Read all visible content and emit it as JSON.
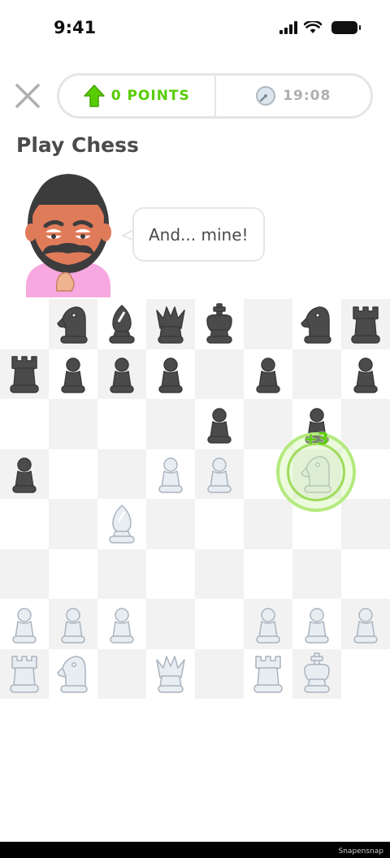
{
  "status_bar": {
    "time": "9:41"
  },
  "header": {
    "points_label": "0 POINTS",
    "timer_label": "19:08"
  },
  "page_title": "Play Chess",
  "opponent": {
    "speech": "And... mine!"
  },
  "move_feedback": {
    "score": "+3"
  },
  "watermark": "Snapensnap",
  "colors": {
    "accent_green": "#58cc02",
    "pill_border": "#e5e5e5",
    "dark_square": "#f2f2f2",
    "black_piece": "#4b4b4b",
    "white_piece": "#e8edf2"
  },
  "board": {
    "ranks": [
      [
        "",
        "bN",
        "bB",
        "bQ",
        "bK",
        "",
        "bN",
        "bR"
      ],
      [
        "bR",
        "bP",
        "bP",
        "bP",
        "",
        "bP",
        "",
        "bP"
      ],
      [
        "",
        "",
        "",
        "",
        "bP",
        "",
        "bP",
        ""
      ],
      [
        "bP",
        "",
        "",
        "wP",
        "wP",
        "",
        "wN",
        ""
      ],
      [
        "",
        "",
        "wB",
        "",
        "",
        "",
        "",
        ""
      ],
      [
        "",
        "",
        "",
        "",
        "",
        "",
        "",
        ""
      ],
      [
        "wP",
        "wP",
        "wP",
        "",
        "",
        "wP",
        "wP",
        "wP"
      ],
      [
        "wR",
        "wN",
        "",
        "wQ",
        "",
        "wR",
        "wK",
        ""
      ]
    ]
  }
}
